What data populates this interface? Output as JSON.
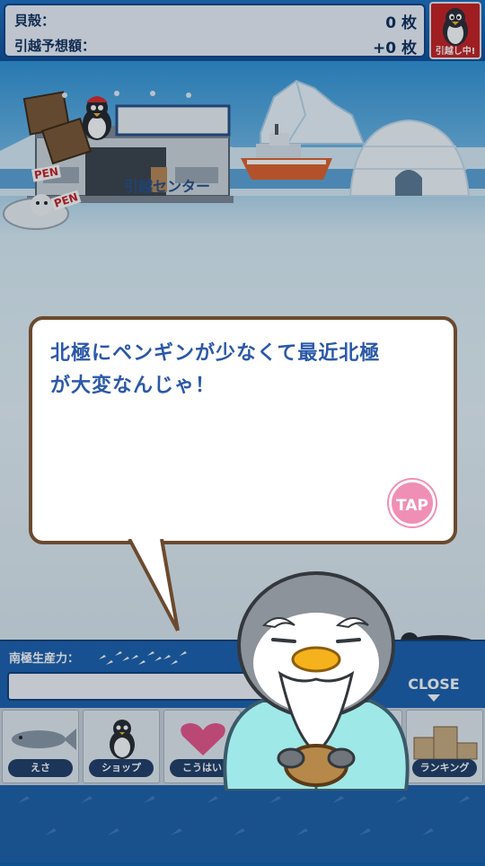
{
  "status": {
    "shells_label": "貝殻：",
    "shells_value": "0 枚",
    "estimate_label": "引越予想額：",
    "estimate_value": "+0 枚",
    "moving_label": "引越し中!"
  },
  "scene": {
    "center_sign": "引越センター",
    "pen_sign_1": "PEN",
    "pen_sign_2": "PEN"
  },
  "dialog": {
    "line1": "北極にペンギンが少なくて最近北極",
    "line2": "が大変なんじゃ！",
    "tap_label": "TAP"
  },
  "panel": {
    "production_label": "南極生産力：",
    "close_label": "CLOSE"
  },
  "menu": {
    "items": [
      {
        "label": "えさ"
      },
      {
        "label": "ショップ"
      },
      {
        "label": "こうはい"
      },
      {
        "label": ""
      },
      {
        "label": ""
      },
      {
        "label": "ランキング"
      }
    ]
  },
  "colors": {
    "accent_blue": "#1a5fae",
    "bubble_border": "#6b4a2e",
    "dialog_text": "#2b58a8",
    "tap_pink": "#f08fb6",
    "moving_red": "#c81e1e"
  }
}
